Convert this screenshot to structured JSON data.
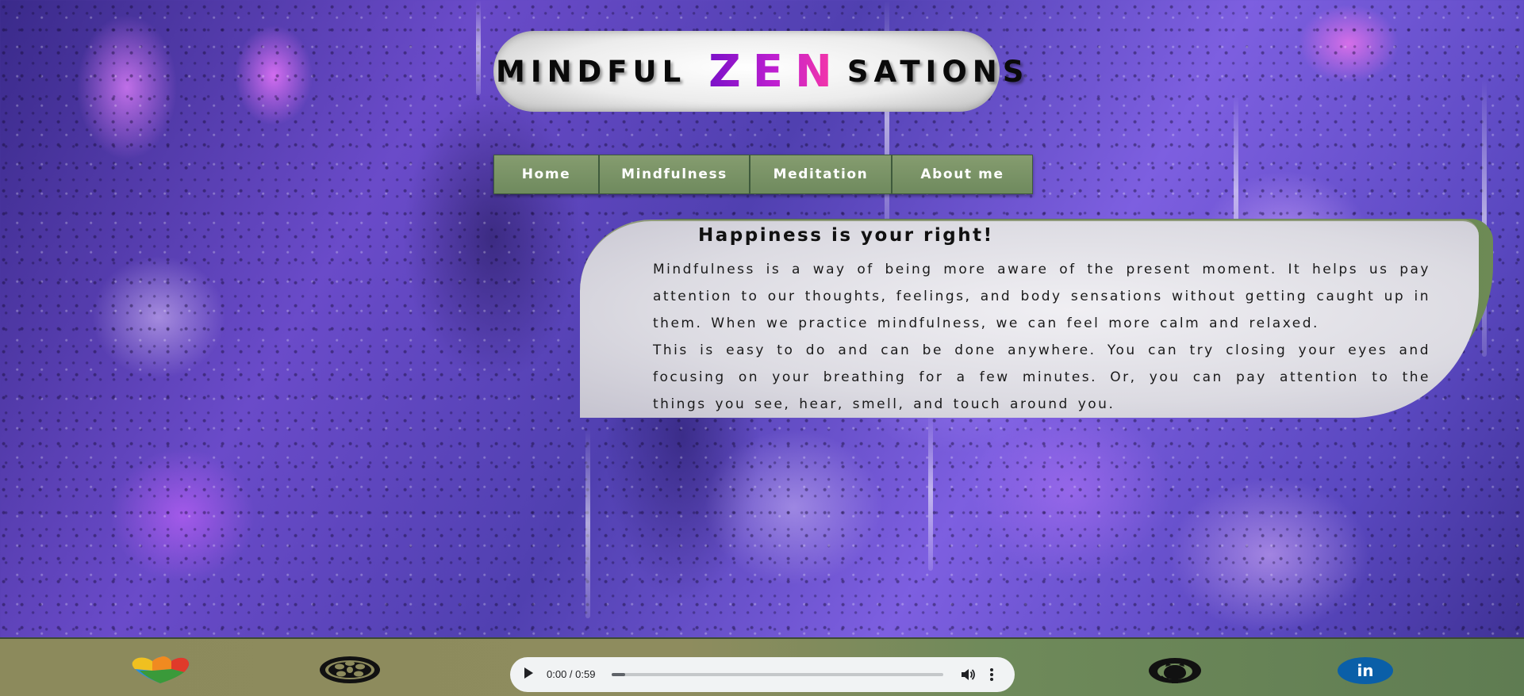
{
  "header": {
    "logo_part1": "MINDFUL",
    "logo_zen": "ZEN",
    "logo_part3": "SATIONS"
  },
  "nav": {
    "items": [
      {
        "label": "Home"
      },
      {
        "label": "Mindfulness"
      },
      {
        "label": "Meditation"
      },
      {
        "label": "About me"
      }
    ]
  },
  "content": {
    "title": "Happiness is your right!",
    "paragraph1": "Mindfulness is a way of being more aware of the present moment. It helps us pay attention to our thoughts, feelings, and body sensations without getting caught up in them. When we practice mindfulness, we can feel more calm and relaxed.",
    "paragraph2": "This is easy to do and can be done anywhere. You can try closing your eyes and focusing on your breathing for a few minutes. Or, you can pay attention to the things you see, hear, smell, and touch around you."
  },
  "footer": {
    "icons": [
      "puzzle-heart-icon",
      "film-reel-icon",
      "github-icon",
      "linkedin-icon"
    ],
    "linkedin_text": "in",
    "audio": {
      "time": "0:00 / 0:59",
      "progress": 0.04
    }
  },
  "colors": {
    "nav_green": "#7a9466",
    "footer_olive": "#8c8a5c",
    "zen_gradient_start": "#7a10c8",
    "zen_gradient_end": "#ff3aa0"
  }
}
